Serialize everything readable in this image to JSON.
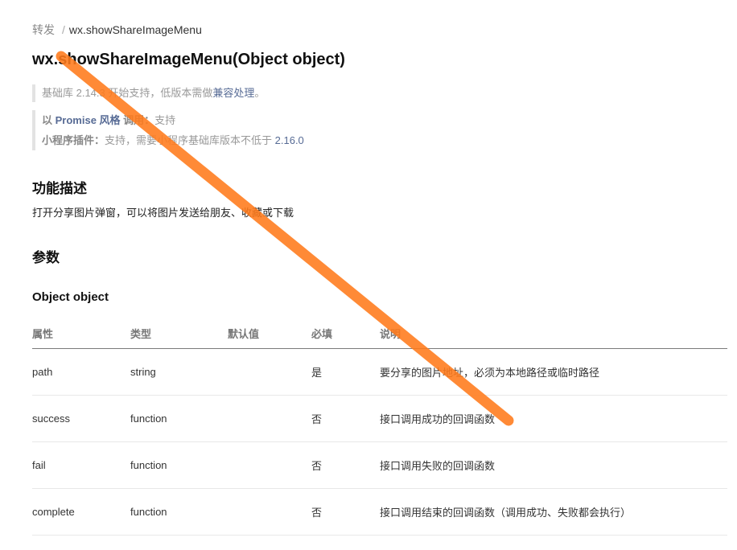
{
  "breadcrumb": {
    "parent": "转发",
    "separator": "/",
    "current": "wx.showShareImageMenu"
  },
  "title": "wx.showShareImageMenu(Object object)",
  "notes": {
    "base_lib_prefix": "基础库 2.14.3 开始支持，低版本需做",
    "compat_link": "兼容处理",
    "base_lib_suffix": "。",
    "promise_prefix": "以 ",
    "promise_link": "Promise 风格",
    "promise_label": " 调用：",
    "promise_value": "支持",
    "plugin_label": "小程序插件：",
    "plugin_text": "支持，需要小程序基础库版本不低于 ",
    "plugin_version": "2.16.0"
  },
  "description": {
    "title": "功能描述",
    "text": "打开分享图片弹窗，可以将图片发送给朋友、收藏或下载"
  },
  "params_title": "参数",
  "object_title": "Object object",
  "table": {
    "headers": [
      "属性",
      "类型",
      "默认值",
      "必填",
      "说明"
    ],
    "rows": [
      [
        "path",
        "string",
        "",
        "是",
        "要分享的图片地址，必须为本地路径或临时路径"
      ],
      [
        "success",
        "function",
        "",
        "否",
        "接口调用成功的回调函数"
      ],
      [
        "fail",
        "function",
        "",
        "否",
        "接口调用失败的回调函数"
      ],
      [
        "complete",
        "function",
        "",
        "否",
        "接口调用结束的回调函数（调用成功、失败都会执行）"
      ]
    ]
  },
  "colors": {
    "link": "#576b95",
    "annotation_stroke": "#ff7a1a"
  }
}
